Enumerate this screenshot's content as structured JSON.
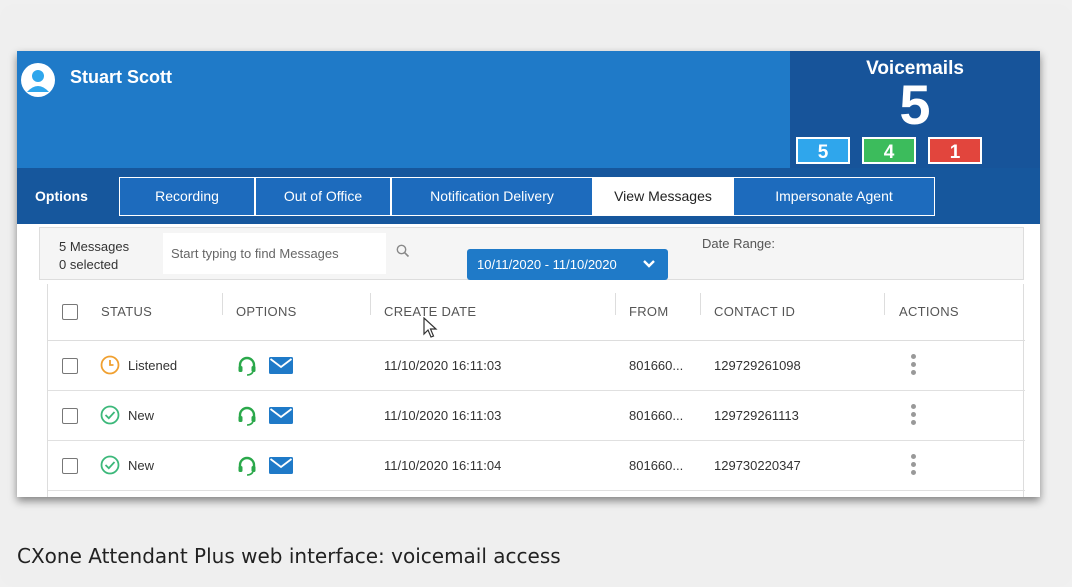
{
  "header": {
    "user_name": "Stuart Scott"
  },
  "voicemails": {
    "title": "Voicemails",
    "total": "5",
    "badges": [
      "5",
      "4",
      "1"
    ]
  },
  "tabs": {
    "options_label": "Options",
    "items": [
      "Recording",
      "Out of Office",
      "Notification Delivery",
      "View Messages",
      "Impersonate Agent"
    ],
    "active": "View Messages"
  },
  "toolbar": {
    "message_count": "5 Messages",
    "selected_count": "0 selected",
    "search_placeholder": "Start typing to find Messages",
    "date_range_label": "Date Range:",
    "date_range_value": "10/11/2020 - 11/10/2020"
  },
  "table": {
    "columns": [
      "STATUS",
      "OPTIONS",
      "CREATE DATE",
      "FROM",
      "CONTACT ID",
      "ACTIONS"
    ],
    "rows": [
      {
        "status": "Listened",
        "create_date": "11/10/2020 16:11:03",
        "from": "801660...",
        "contact_id": "129729261098"
      },
      {
        "status": "New",
        "create_date": "11/10/2020 16:11:03",
        "from": "801660...",
        "contact_id": "129729261113"
      },
      {
        "status": "New",
        "create_date": "11/10/2020 16:11:04",
        "from": "801660...",
        "contact_id": "129730220347"
      }
    ]
  },
  "colors": {
    "header_blue": "#1f7ac8",
    "tabbar_blue": "#16579d",
    "listened_orange": "#f0a030",
    "new_green": "#3cb87a",
    "badge_blue": "#2fa6ec",
    "badge_green": "#3cbc5c",
    "badge_red": "#e2453d"
  },
  "caption": "CXone Attendant Plus web interface: voicemail access"
}
